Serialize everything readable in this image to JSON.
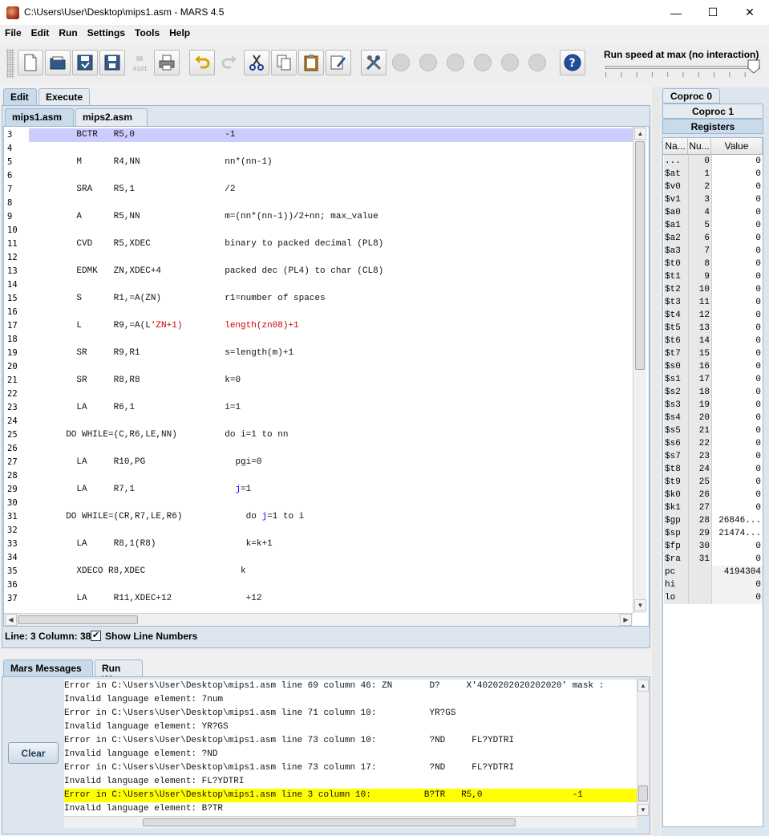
{
  "window": {
    "title": "C:\\Users\\User\\Desktop\\mips1.asm  - MARS 4.5",
    "minimize": "—",
    "maximize": "☐",
    "close": "✕"
  },
  "menu": [
    "File",
    "Edit",
    "Run",
    "Settings",
    "Tools",
    "Help"
  ],
  "toolbar": {
    "speed_label": "Run speed at max (no interaction)",
    "speed_level": 1.0,
    "icons": [
      "new-file-icon",
      "open-file-icon",
      "save-icon",
      "save-as-icon",
      "dump-memory-icon",
      "print-icon",
      "undo-icon",
      "redo-icon",
      "cut-icon",
      "copy-icon",
      "paste-icon",
      "find-replace-icon",
      "assemble-icon",
      "run-icon",
      "step-icon",
      "backstep-icon",
      "pause-icon",
      "stop-icon",
      "reset-icon",
      "help-icon"
    ]
  },
  "main_tabs": [
    "Edit",
    "Execute"
  ],
  "file_tabs": [
    "mips1.asm",
    "mips2.asm"
  ],
  "editor": {
    "first_line": 3,
    "highlight_line": 3,
    "lines": [
      "         BCTR   R5,0                 -1",
      "",
      "         M      R4,NN                nn*(nn-1)",
      "",
      "         SRA    R5,1                 /2",
      "",
      "         A      R5,NN                m=(nn*(nn-1))/2+nn; max_value",
      "",
      "         CVD    R5,XDEC              binary to packed decimal (PL8)",
      "",
      "         EDMK   ZN,XDEC+4            packed dec (PL4) to char (CL8)",
      "",
      "         S      R1,=A(ZN)            r1=number of spaces",
      "",
      "         L      R9,=A(L'ZN+1)        length(zn08)+1",
      "",
      "         SR     R9,R1                s=length(m)+1",
      "",
      "         SR     R8,R8                k=0",
      "",
      "         LA     R6,1                 i=1",
      "",
      "       DO WHILE=(C,R6,LE,NN)         do i=1 to nn",
      "",
      "         LA     R10,PG                 pgi=0",
      "",
      "         LA     R7,1                   j=1",
      "",
      "       DO WHILE=(CR,R7,LE,R6)            do j=1 to i",
      "",
      "         LA     R8,1(R8)                 k=k+1",
      "",
      "         XDECO R8,XDEC                  k",
      "",
      "         LA     R11,XDEC+12              +12"
    ],
    "status": "Line: 3 Column: 38",
    "show_line_numbers_label": "Show Line Numbers",
    "show_line_numbers_checked": "✔"
  },
  "messages": {
    "tabs": [
      "Mars Messages",
      "Run I/O"
    ],
    "clear_label": "Clear",
    "highlight_index": 8,
    "lines": [
      "Error in C:\\Users\\User\\Desktop\\mips1.asm line 69 column 46: ZN       D?     X'4020202020202020' mask :",
      "Invalid language element: 7num",
      "Error in C:\\Users\\User\\Desktop\\mips1.asm line 71 column 10:          YR?GS",
      "Invalid language element: YR?GS",
      "Error in C:\\Users\\User\\Desktop\\mips1.asm line 73 column 10:          ?ND     FL?YDTRI",
      "Invalid language element: ?ND",
      "Error in C:\\Users\\User\\Desktop\\mips1.asm line 73 column 17:          ?ND     FL?YDTRI",
      "Invalid language element: FL?YDTRI",
      "Error in C:\\Users\\User\\Desktop\\mips1.asm line 3 column 10:          B?TR   R5,0                 -1",
      "Invalid language element: B?TR"
    ]
  },
  "registers": {
    "tabs": [
      "Coproc 0",
      "Coproc 1",
      "Registers"
    ],
    "headers": [
      "Na...",
      "Nu...",
      "Value"
    ],
    "rows": [
      {
        "name": "...",
        "num": "0",
        "value": "0"
      },
      {
        "name": "$at",
        "num": "1",
        "value": "0"
      },
      {
        "name": "$v0",
        "num": "2",
        "value": "0"
      },
      {
        "name": "$v1",
        "num": "3",
        "value": "0"
      },
      {
        "name": "$a0",
        "num": "4",
        "value": "0"
      },
      {
        "name": "$a1",
        "num": "5",
        "value": "0"
      },
      {
        "name": "$a2",
        "num": "6",
        "value": "0"
      },
      {
        "name": "$a3",
        "num": "7",
        "value": "0"
      },
      {
        "name": "$t0",
        "num": "8",
        "value": "0"
      },
      {
        "name": "$t1",
        "num": "9",
        "value": "0"
      },
      {
        "name": "$t2",
        "num": "10",
        "value": "0"
      },
      {
        "name": "$t3",
        "num": "11",
        "value": "0"
      },
      {
        "name": "$t4",
        "num": "12",
        "value": "0"
      },
      {
        "name": "$t5",
        "num": "13",
        "value": "0"
      },
      {
        "name": "$t6",
        "num": "14",
        "value": "0"
      },
      {
        "name": "$t7",
        "num": "15",
        "value": "0"
      },
      {
        "name": "$s0",
        "num": "16",
        "value": "0"
      },
      {
        "name": "$s1",
        "num": "17",
        "value": "0"
      },
      {
        "name": "$s2",
        "num": "18",
        "value": "0"
      },
      {
        "name": "$s3",
        "num": "19",
        "value": "0"
      },
      {
        "name": "$s4",
        "num": "20",
        "value": "0"
      },
      {
        "name": "$s5",
        "num": "21",
        "value": "0"
      },
      {
        "name": "$s6",
        "num": "22",
        "value": "0"
      },
      {
        "name": "$s7",
        "num": "23",
        "value": "0"
      },
      {
        "name": "$t8",
        "num": "24",
        "value": "0"
      },
      {
        "name": "$t9",
        "num": "25",
        "value": "0"
      },
      {
        "name": "$k0",
        "num": "26",
        "value": "0"
      },
      {
        "name": "$k1",
        "num": "27",
        "value": "0"
      },
      {
        "name": "$gp",
        "num": "28",
        "value": "26846..."
      },
      {
        "name": "$sp",
        "num": "29",
        "value": "21474..."
      },
      {
        "name": "$fp",
        "num": "30",
        "value": "0"
      },
      {
        "name": "$ra",
        "num": "31",
        "value": "0"
      },
      {
        "name": "pc",
        "num": "",
        "value": "4194304"
      },
      {
        "name": "hi",
        "num": "",
        "value": "0"
      },
      {
        "name": "lo",
        "num": "",
        "value": "0"
      }
    ]
  },
  "colors": {
    "line_highlight": "#ccccff",
    "error_highlight": "#ffff00",
    "comment_red": "#d10000",
    "keyword_blue": "#0000ff"
  }
}
